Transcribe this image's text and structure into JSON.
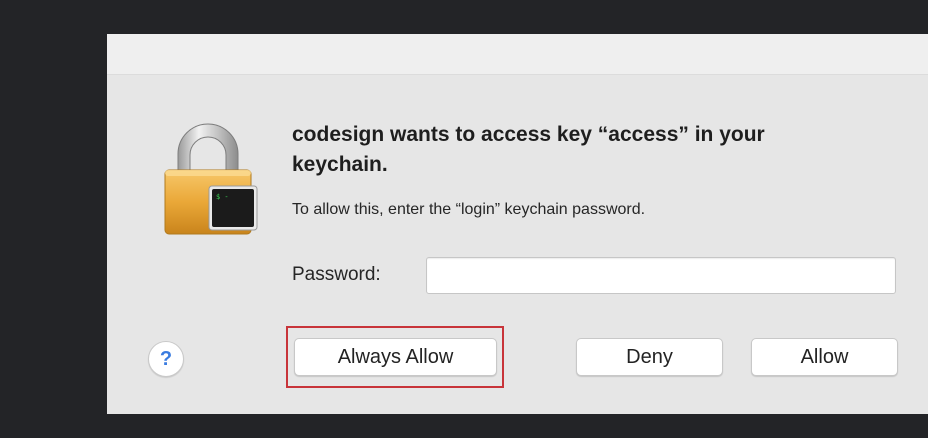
{
  "dialog": {
    "heading": "codesign wants to access key “access” in your keychain.",
    "message": "To allow this, enter the “login” keychain password.",
    "password_label": "Password:",
    "password_value": "",
    "password_placeholder": "",
    "help_label": "?",
    "buttons": {
      "always_allow": "Always Allow",
      "deny": "Deny",
      "allow": "Allow"
    }
  },
  "icon": {
    "name": "keychain-lock-terminal-icon",
    "terminal_text": "$ -"
  },
  "colors": {
    "background": "#232427",
    "dialog": "#e6e6e6",
    "highlight": "#c8343a",
    "help": "#3a7ce0"
  }
}
